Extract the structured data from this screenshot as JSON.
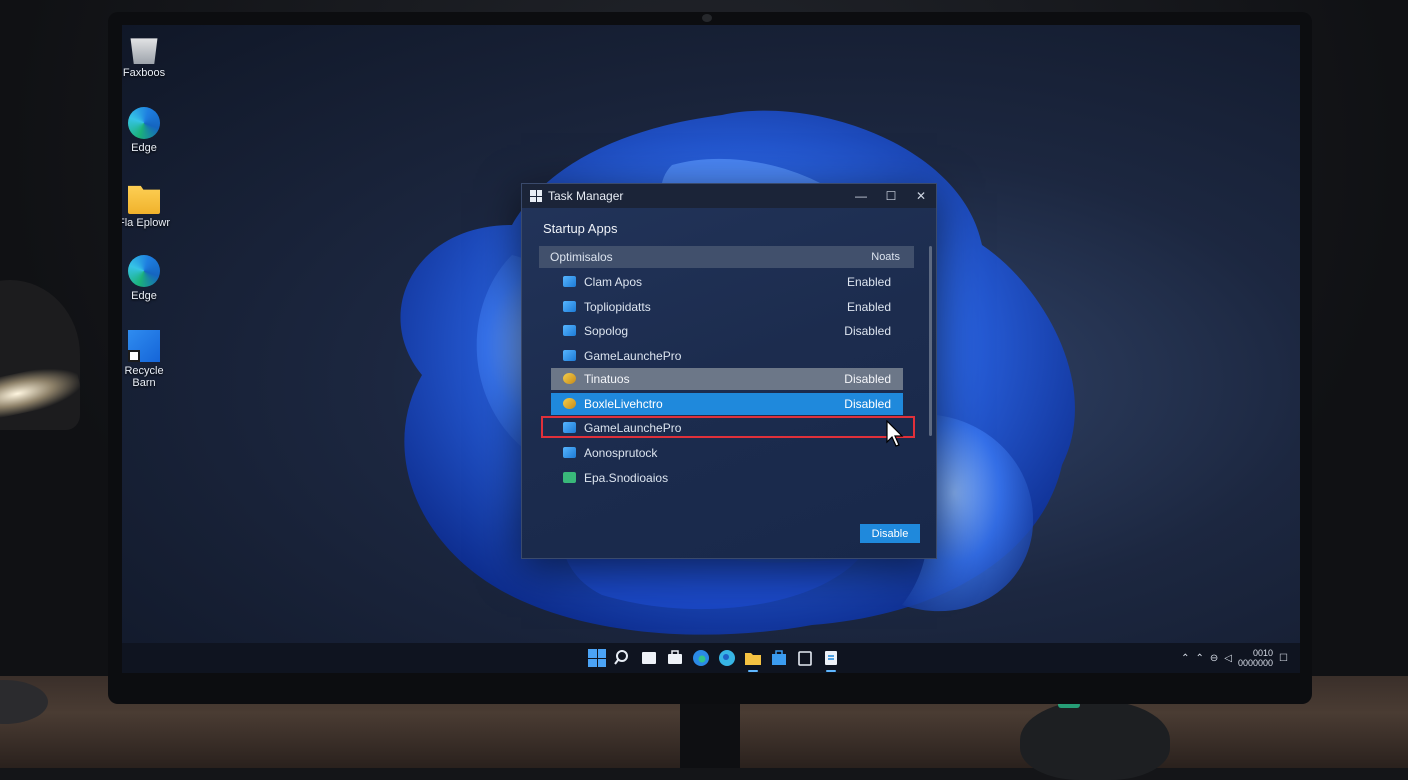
{
  "desktop": {
    "icons": [
      {
        "label": "Faxboos",
        "icon": "recycle-bin-icon"
      },
      {
        "label": "Edge",
        "icon": "edge-icon"
      },
      {
        "label": "Fla Eplowr",
        "icon": "folder-icon"
      },
      {
        "label": "Edge",
        "icon": "edge-icon"
      },
      {
        "label": "Recycle Barn",
        "icon": "recycle-bin-icon"
      }
    ]
  },
  "task_manager": {
    "title": "Task Manager",
    "controls": {
      "minimize": "—",
      "maximize": "☐",
      "close": "✕"
    },
    "heading": "Startup Apps",
    "header_left": "Optimisalos",
    "header_right": "Noats",
    "rows": [
      {
        "name": "Clam Apos",
        "status": "Enabled"
      },
      {
        "name": "Topliopidatts",
        "status": "Enabled"
      },
      {
        "name": "Sopolog",
        "status": "Disabled"
      },
      {
        "name": "GameLaunchePro",
        "status": ""
      },
      {
        "name": "Tinatuos",
        "status": "Disabled"
      },
      {
        "name": "BoxleLivehctro",
        "status": "Disabled"
      },
      {
        "name": "GameLaunchePro",
        "status": ""
      },
      {
        "name": "Aonosprutock",
        "status": ""
      },
      {
        "name": "Epa.Snodioaios",
        "status": ""
      }
    ],
    "selected_row_index": 5,
    "hover_row_index": 4,
    "action_button": "Disable"
  },
  "taskbar": {
    "icons": [
      "start-icon",
      "search-icon",
      "file-icon",
      "briefcase-icon",
      "edge-icon",
      "edge-icon",
      "folder-icon",
      "store-icon",
      "clipboard-icon",
      "task-manager-icon"
    ],
    "clock_time": "0010",
    "clock_date": "0000000"
  },
  "colors": {
    "accent": "#1f89dc",
    "highlight_outline": "#e0303a"
  }
}
